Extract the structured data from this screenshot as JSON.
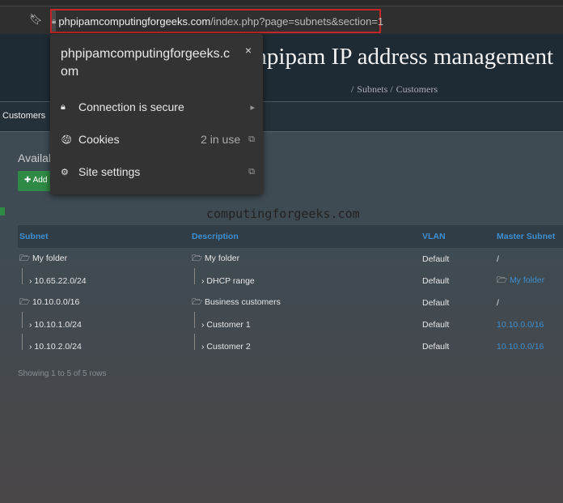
{
  "browser": {
    "url_host": "phpipamcomputingforgeeks.com",
    "url_path": "/index.php?page=subnets&section=1"
  },
  "site_info": {
    "host": "phpipamcomputingforgeeks.com",
    "close": "×",
    "items": [
      {
        "icon": "lock-icon",
        "label": "Connection is secure",
        "arrow": "▸"
      },
      {
        "icon": "cookie-icon",
        "label": "Cookies",
        "value": "2 in use",
        "arrow": "⧉"
      },
      {
        "icon": "gear-icon",
        "label": "Site settings",
        "arrow": "⧉"
      }
    ]
  },
  "header": {
    "title": "phpipam IP address management",
    "breadcrumb": [
      "Subnets",
      "Customers"
    ]
  },
  "nav": {
    "active": "Customers"
  },
  "main": {
    "heading": "Available subnets",
    "add_label": "✚ Add",
    "watermark": "computingforgeeks.com",
    "columns": [
      "Subnet",
      "Description",
      "VLAN",
      "Master Subnet"
    ],
    "rows": [
      {
        "subnet": "My folder",
        "desc": "My folder",
        "vlan": "Default",
        "master": "/"
      },
      {
        "subnet": "10.65.22.0/24",
        "desc": "DHCP range",
        "vlan": "Default",
        "master": "My folder"
      },
      {
        "subnet": "10.10.0.0/16",
        "desc": "Business customers",
        "vlan": "Default",
        "master": "/"
      },
      {
        "subnet": "10.10.1.0/24",
        "desc": "Customer 1",
        "vlan": "Default",
        "master": "10.10.0.0/16"
      },
      {
        "subnet": "10.10.2.0/24",
        "desc": "Customer 2",
        "vlan": "Default",
        "master": "10.10.0.0/16"
      }
    ],
    "footer": "Showing 1 to 5 of 5 rows"
  },
  "colors": {
    "accent": "#3d8fd1",
    "highlight": "#c0262a",
    "add_button": "#2f8a45"
  }
}
